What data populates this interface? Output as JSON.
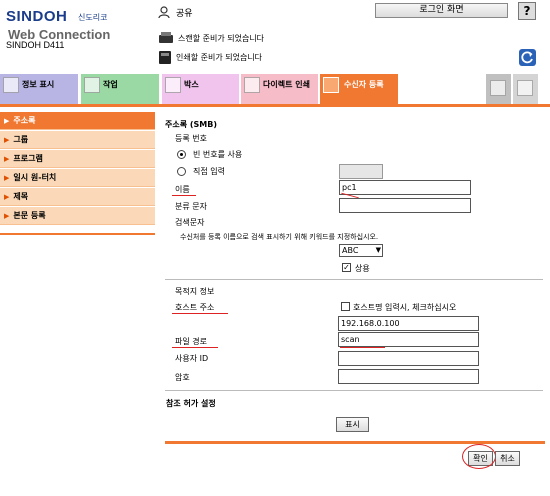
{
  "header": {
    "brand": "SINDOH",
    "brand_ko": "신도리코",
    "app_name": "Web Connection",
    "model": "SINDOH D411",
    "user_label": "공유",
    "login_button": "로그인 화면",
    "help_label": "?",
    "status_scan": "스캔할 준비가 되었습니다",
    "status_print": "인쇄할 준비가 되었습니다"
  },
  "tabs": [
    {
      "label": "정보 표시",
      "icon": "info-icon"
    },
    {
      "label": "작업",
      "icon": "job-icon"
    },
    {
      "label": "박스",
      "icon": "box-icon"
    },
    {
      "label": "다이렉트 인쇄",
      "icon": "direct-print-icon"
    },
    {
      "label": "수신자 등록",
      "icon": "destination-icon"
    }
  ],
  "sidebar": {
    "items": [
      {
        "label": "주소록"
      },
      {
        "label": "그룹"
      },
      {
        "label": "프로그램"
      },
      {
        "label": "일시 원-터치"
      },
      {
        "label": "제목"
      },
      {
        "label": "본문 등록"
      }
    ]
  },
  "form": {
    "title": "주소록 (SMB)",
    "reg_number_label": "등록 번호",
    "radio_empty": "빈 번호를 사용",
    "radio_direct": "직접 입력",
    "name_label": "이름",
    "name_value": "pc1",
    "sort_label": "분류 문자",
    "sort_value": "",
    "search_label": "검색문자",
    "search_hint": "수신처를 등록 이름으로 검색 표시하기 위해 키워드를 지정하십시오.",
    "search_select": "ABC",
    "frequent_label": "상용",
    "dest_info_label": "목적지 정보",
    "host_label": "호스트 주소",
    "host_check_label": "호스트명 입력시, 체크하십시오",
    "host_value": "192.168.0.100",
    "path_label": "파일 경로",
    "path_value": "scan",
    "user_id_label": "사용자 ID",
    "user_id_value": "",
    "password_label": "암호",
    "password_value": "",
    "ref_label": "참조 허가 설정",
    "show_button": "표시",
    "ok_button": "확인",
    "cancel_button": "취소"
  },
  "colors": {
    "accent": "#f07830",
    "sidebar_bg": "#fbd9b8",
    "annotation": "#dd2222"
  }
}
